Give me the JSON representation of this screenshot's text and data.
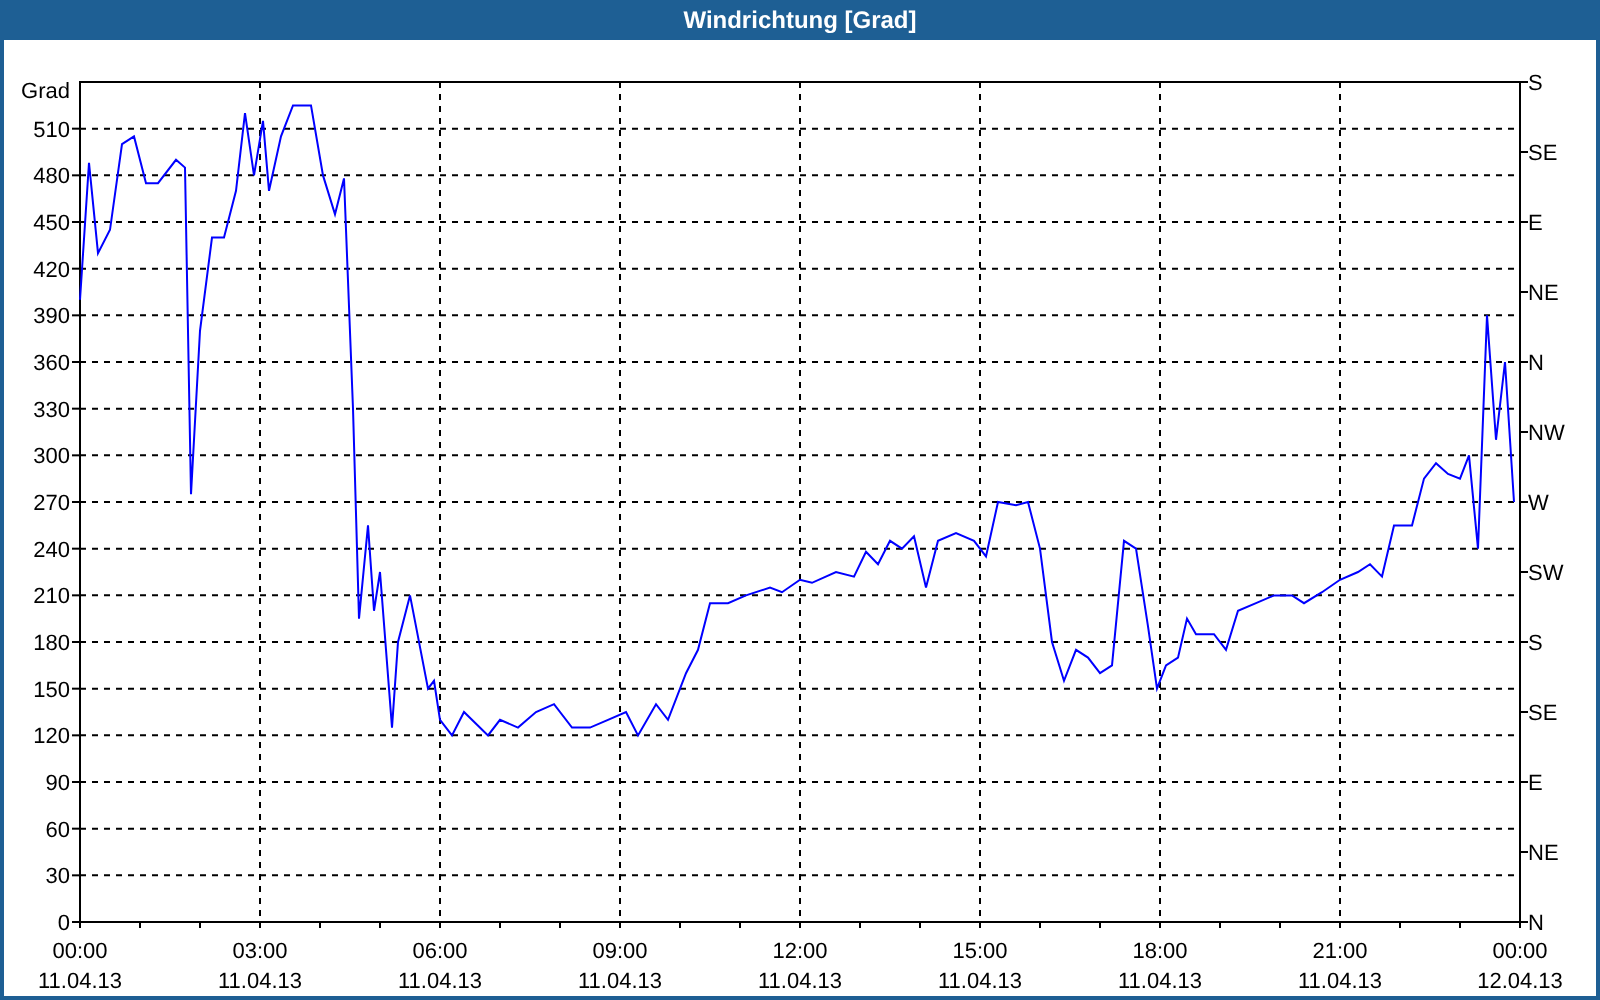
{
  "window": {
    "title": "Windrichtung [Grad]"
  },
  "chart": {
    "chart_data": {
      "type": "line",
      "grid": true,
      "ylabel": "Grad",
      "ylim": [
        0,
        540
      ],
      "xlim": [
        0,
        24
      ],
      "yticks": [
        0,
        30,
        60,
        90,
        120,
        150,
        180,
        210,
        240,
        270,
        300,
        330,
        360,
        390,
        420,
        450,
        480,
        510
      ],
      "xticks": [
        {
          "value": 0,
          "label": "00:00"
        },
        {
          "value": 3,
          "label": "03:00"
        },
        {
          "value": 6,
          "label": "06:00"
        },
        {
          "value": 9,
          "label": "09:00"
        },
        {
          "value": 12,
          "label": "12:00"
        },
        {
          "value": 15,
          "label": "15:00"
        },
        {
          "value": 18,
          "label": "18:00"
        },
        {
          "value": 21,
          "label": "21:00"
        },
        {
          "value": 24,
          "label": "00:00"
        }
      ],
      "x": [
        0,
        0.15,
        0.3,
        0.5,
        0.7,
        0.9,
        1.1,
        1.3,
        1.6,
        1.75,
        1.85,
        2.0,
        2.2,
        2.4,
        2.6,
        2.75,
        2.9,
        3.05,
        3.15,
        3.35,
        3.55,
        3.85,
        4.05,
        4.25,
        4.4,
        4.55,
        4.65,
        4.8,
        4.9,
        5.0,
        5.2,
        5.3,
        5.5,
        5.6,
        5.8,
        5.9,
        6.0,
        6.2,
        6.4,
        6.8,
        7.0,
        7.3,
        7.6,
        7.9,
        8.2,
        8.5,
        8.8,
        9.1,
        9.3,
        9.6,
        9.8,
        10.1,
        10.3,
        10.5,
        10.8,
        11.1,
        11.5,
        11.7,
        12.0,
        12.2,
        12.6,
        12.9,
        13.1,
        13.3,
        13.5,
        13.7,
        13.9,
        14.1,
        14.3,
        14.6,
        14.9,
        15.1,
        15.3,
        15.6,
        15.8,
        16.0,
        16.2,
        16.4,
        16.6,
        16.8,
        17.0,
        17.2,
        17.4,
        17.6,
        17.8,
        17.95,
        18.1,
        18.3,
        18.45,
        18.6,
        18.9,
        19.1,
        19.3,
        19.6,
        19.9,
        20.2,
        20.4,
        20.7,
        21.0,
        21.3,
        21.5,
        21.7,
        21.9,
        22.2,
        22.4,
        22.6,
        22.8,
        23.0,
        23.15,
        23.3,
        23.45,
        23.6,
        23.75,
        23.9
      ],
      "series": [
        {
          "color": "#0000ff",
          "values": [
            400,
            488,
            430,
            445,
            500,
            505,
            475,
            475,
            490,
            485,
            275,
            380,
            440,
            440,
            470,
            520,
            480,
            515,
            470,
            505,
            525,
            525,
            480,
            455,
            478,
            330,
            195,
            255,
            200,
            225,
            125,
            180,
            210,
            190,
            150,
            155,
            130,
            120,
            135,
            120,
            130,
            125,
            135,
            140,
            125,
            125,
            130,
            135,
            120,
            140,
            130,
            160,
            175,
            205,
            205,
            210,
            215,
            212,
            220,
            218,
            225,
            222,
            238,
            230,
            245,
            240,
            248,
            215,
            245,
            250,
            245,
            235,
            270,
            268,
            270,
            240,
            180,
            155,
            175,
            170,
            160,
            165,
            245,
            240,
            190,
            150,
            165,
            170,
            195,
            185,
            185,
            175,
            200,
            205,
            210,
            210,
            205,
            212,
            220,
            225,
            230,
            222,
            255,
            255,
            285,
            295,
            288,
            285,
            300,
            240,
            390,
            310,
            360,
            270
          ]
        }
      ]
    },
    "x_dates": [
      "11.04.13",
      "11.04.13",
      "11.04.13",
      "11.04.13",
      "11.04.13",
      "11.04.13",
      "11.04.13",
      "11.04.13",
      "12.04.13"
    ],
    "right_axis_labels": [
      "S",
      "SE",
      "E",
      "NE",
      "N",
      "NW",
      "W",
      "SW",
      "S",
      "SE",
      "E",
      "NE",
      "N"
    ]
  }
}
